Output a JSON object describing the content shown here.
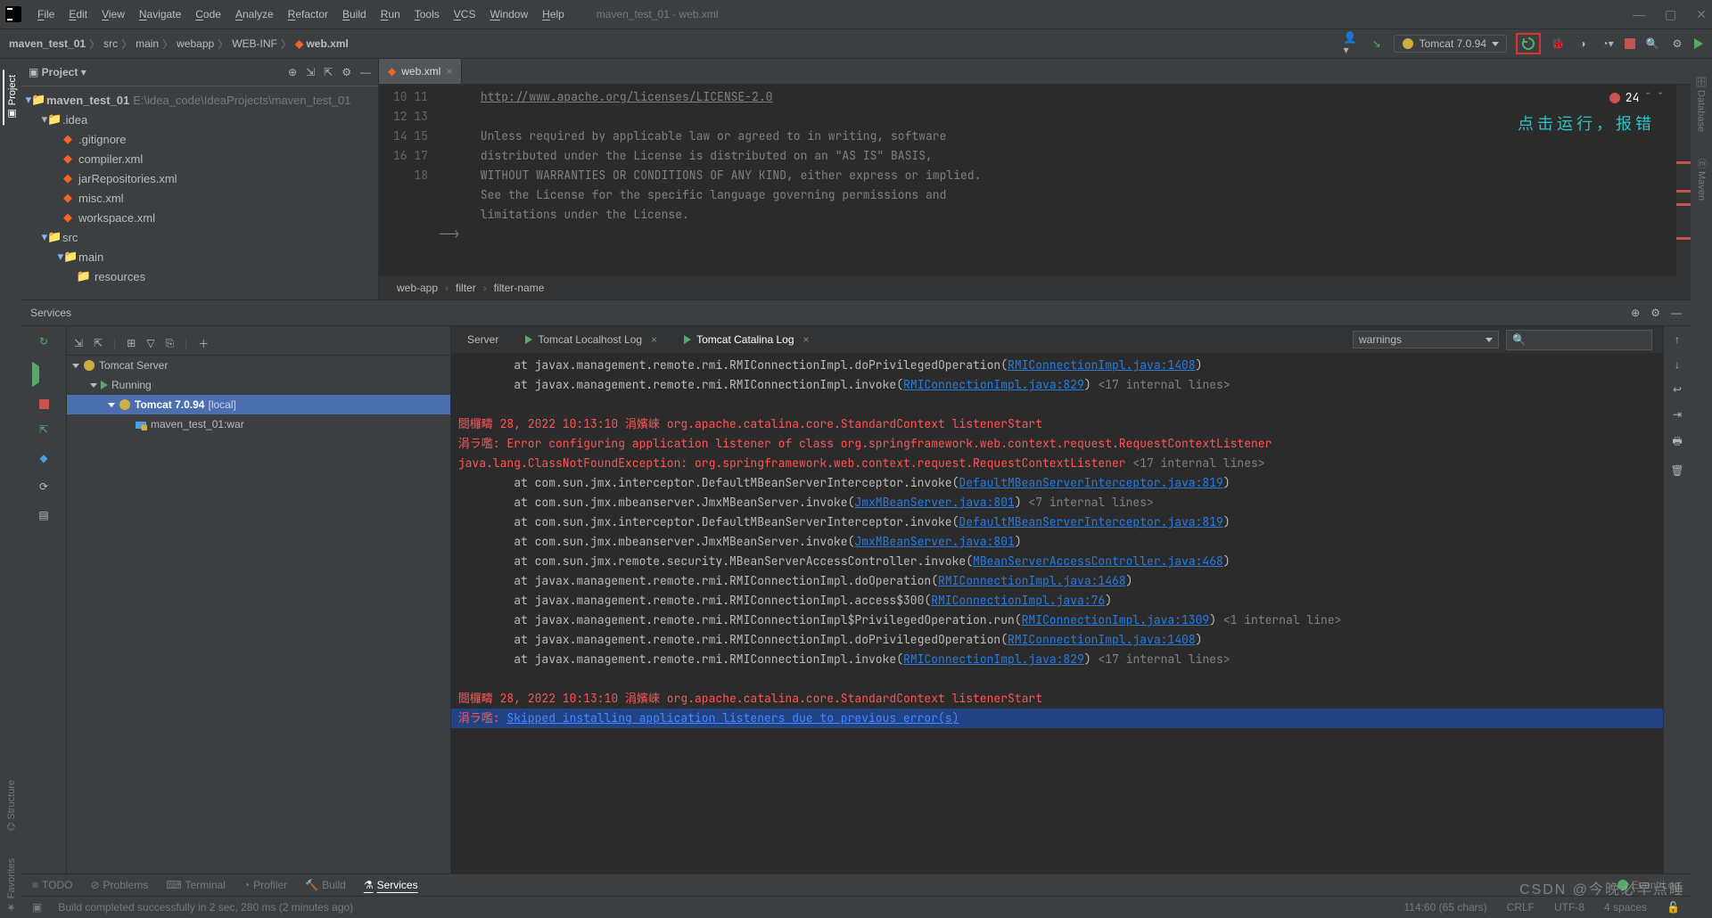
{
  "window_title": "maven_test_01 - web.xml",
  "menus": [
    "File",
    "Edit",
    "View",
    "Navigate",
    "Code",
    "Analyze",
    "Refactor",
    "Build",
    "Run",
    "Tools",
    "VCS",
    "Window",
    "Help"
  ],
  "breadcrumbs": [
    "maven_test_01",
    "src",
    "main",
    "webapp",
    "WEB-INF",
    "web.xml"
  ],
  "run_configuration": "Tomcat 7.0.94",
  "project_panel": {
    "title": "Project",
    "root": "maven_test_01",
    "root_path": "E:\\idea_code\\IdeaProjects\\maven_test_01",
    "idea_folder": ".idea",
    "files": [
      ".gitignore",
      "compiler.xml",
      "jarRepositories.xml",
      "misc.xml",
      "workspace.xml"
    ],
    "src": "src",
    "main": "main",
    "resources": "resources"
  },
  "editor": {
    "tab": "web.xml",
    "line_start": 10,
    "lines": [
      "http://www.apache.org/licenses/LICENSE-2.0",
      "",
      "Unless required by applicable law or agreed to in writing, software",
      "distributed under the License is distributed on an \"AS IS\" BASIS,",
      "WITHOUT WARRANTIES OR CONDITIONS OF ANY KIND, either express or implied.",
      "See the License for the specific language governing permissions and",
      "limitations under the License.",
      "-->",
      ""
    ],
    "error_count": "24",
    "run_note": "点击运行，报错",
    "crumbs": [
      "web-app",
      "filter",
      "filter-name"
    ]
  },
  "services": {
    "title": "Services",
    "tree_root": "Tomcat Server",
    "running": "Running",
    "server": "Tomcat 7.0.94",
    "server_suffix": "[local]",
    "artifact": "maven_test_01:war",
    "tabs": {
      "server": "Server",
      "localhost": "Tomcat Localhost Log",
      "catalina": "Tomcat Catalina Log"
    },
    "filter": "warnings",
    "search_placeholder": ""
  },
  "log": [
    {
      "c": "w",
      "pad": 4,
      "t": "at javax.management.remote.rmi.RMIConnectionImpl.doPrivilegedOperation(",
      "l": "RMIConnectionImpl.java:1408",
      "t2": ")"
    },
    {
      "c": "w",
      "pad": 4,
      "t": "at javax.management.remote.rmi.RMIConnectionImpl.invoke(",
      "l": "RMIConnectionImpl.java:829",
      "t2": ")",
      "g": " <17 internal lines>"
    },
    {
      "c": "",
      "t": ""
    },
    {
      "c": "r",
      "pad": 0,
      "t": "閸欏疇 28, 2022 10:13:10 涓嬪崍 org.apache.catalina.core.StandardContext listenerStart"
    },
    {
      "c": "r",
      "pad": 0,
      "t": "涓ラ嚂: Error configuring application listener of class org.springframework.web.context.request.RequestContextListener"
    },
    {
      "c": "r",
      "pad": 0,
      "t": "java.lang.ClassNotFoundException: org.springframework.web.context.request.RequestContextListener",
      "g": " <17 internal lines>"
    },
    {
      "c": "w",
      "pad": 4,
      "t": "at com.sun.jmx.interceptor.DefaultMBeanServerInterceptor.invoke(",
      "l": "DefaultMBeanServerInterceptor.java:819",
      "t2": ")"
    },
    {
      "c": "w",
      "pad": 4,
      "t": "at com.sun.jmx.mbeanserver.JmxMBeanServer.invoke(",
      "l": "JmxMBeanServer.java:801",
      "t2": ")",
      "g": " <7 internal lines>"
    },
    {
      "c": "w",
      "pad": 4,
      "t": "at com.sun.jmx.interceptor.DefaultMBeanServerInterceptor.invoke(",
      "l": "DefaultMBeanServerInterceptor.java:819",
      "t2": ")"
    },
    {
      "c": "w",
      "pad": 4,
      "t": "at com.sun.jmx.mbeanserver.JmxMBeanServer.invoke(",
      "l": "JmxMBeanServer.java:801",
      "t2": ")"
    },
    {
      "c": "w",
      "pad": 4,
      "t": "at com.sun.jmx.remote.security.MBeanServerAccessController.invoke(",
      "l": "MBeanServerAccessController.java:468",
      "t2": ")"
    },
    {
      "c": "w",
      "pad": 4,
      "t": "at javax.management.remote.rmi.RMIConnectionImpl.doOperation(",
      "l": "RMIConnectionImpl.java:1468",
      "t2": ")"
    },
    {
      "c": "w",
      "pad": 4,
      "t": "at javax.management.remote.rmi.RMIConnectionImpl.access$300(",
      "l": "RMIConnectionImpl.java:76",
      "t2": ")"
    },
    {
      "c": "w",
      "pad": 4,
      "t": "at javax.management.remote.rmi.RMIConnectionImpl$PrivilegedOperation.run(",
      "l": "RMIConnectionImpl.java:1309",
      "t2": ")",
      "g": " <1 internal line>"
    },
    {
      "c": "w",
      "pad": 4,
      "t": "at javax.management.remote.rmi.RMIConnectionImpl.doPrivilegedOperation(",
      "l": "RMIConnectionImpl.java:1408",
      "t2": ")"
    },
    {
      "c": "w",
      "pad": 4,
      "t": "at javax.management.remote.rmi.RMIConnectionImpl.invoke(",
      "l": "RMIConnectionImpl.java:829",
      "t2": ")",
      "g": " <17 internal lines>"
    },
    {
      "c": "",
      "t": ""
    },
    {
      "c": "r",
      "pad": 0,
      "t": "閸欏疇 28, 2022 10:13:10 涓嬪崍 org.apache.catalina.core.StandardContext listenerStart"
    },
    {
      "c": "r",
      "pad": 0,
      "sel": true,
      "prefix": "涓ラ嚂: ",
      "blue": "Skipped installing application listeners due to previous error(s)"
    }
  ],
  "toolwindows": {
    "todo": "TODO",
    "problems": "Problems",
    "terminal": "Terminal",
    "profiler": "Profiler",
    "build": "Build",
    "services": "Services",
    "eventlog": "Event Log"
  },
  "statusbar": {
    "build_msg": "Build completed successfully in 2 sec, 280 ms (2 minutes ago)",
    "pos": "114:60 (65 chars)",
    "lf": "CRLF",
    "enc": "UTF-8",
    "indent": "4 spaces"
  },
  "watermark": "CSDN @今晚必早点睡"
}
